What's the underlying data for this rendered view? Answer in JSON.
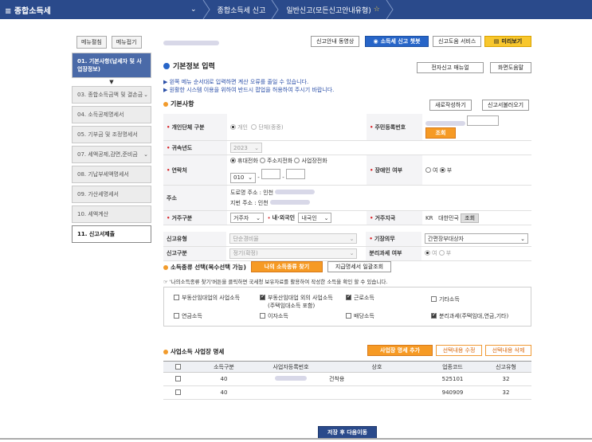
{
  "topbar": {
    "menu_label": "≡ 종합소득세",
    "crumbs": [
      "종합소득세 신고",
      "일반신고(모든신고안내유형)"
    ],
    "home_chevron": "⌄"
  },
  "sidebar": {
    "btn_expand": "메뉴펼침",
    "btn_collapse": "메뉴접기",
    "items": [
      {
        "label": "01. 기본사항(납세자 및 사업장정보)",
        "state": "active"
      },
      {
        "label": "03. 종합소득금액 및 결손금",
        "state": "normal",
        "chev": true
      },
      {
        "label": "04. 소득공제명세서",
        "state": "normal"
      },
      {
        "label": "05. 기부금 및 조정명세서",
        "state": "normal"
      },
      {
        "label": "07. 세액공제,감면,준비금",
        "state": "normal",
        "chev": true
      },
      {
        "label": "08. 기납부세액명세서",
        "state": "normal"
      },
      {
        "label": "09. 가산세명세서",
        "state": "normal"
      },
      {
        "label": "10. 세액계산",
        "state": "normal"
      },
      {
        "label": "11. 신고서제출",
        "state": "current"
      }
    ]
  },
  "toolbar": {
    "video_guide": "신고안내 동영상",
    "chatbot": "소득세 신고 챗봇",
    "help_service": "신고도움 서비스",
    "preview": "미리보기"
  },
  "basic": {
    "title": "기본정보 입력",
    "manual_btn": "전자신고 매뉴얼",
    "help_btn": "화면도움말",
    "note1": "▶ 왼쪽 메뉴 순서대로 입력하면 계산 오류를 줄일 수 있습니다.",
    "note2": "▶ 원활한 시스템 이용을 위하여 반드시 팝업을 허용하여 주시기 바랍니다.",
    "subtitle": "기본사항",
    "new_btn": "새로작성하기",
    "load_btn": "신고서불러오기"
  },
  "form": {
    "taxpayer_type_label": "개인단체 구분",
    "individual": "개인",
    "group": "단체(종중)",
    "rrn_label": "주민등록번호",
    "lookup_btn": "조회",
    "year_label": "귀속년도",
    "year_value": "2023",
    "contact_label": "연락처",
    "contact_mobile": "휴대전화",
    "contact_home": "주소지전화",
    "contact_office": "사업장전화",
    "phone_prefix": "010",
    "disabled_label": "장애인 여부",
    "yes": "여",
    "no": "부",
    "address_label": "주소",
    "road_address": "도로명 주소 : 인천",
    "lot_address": "지번 주소 : 인천",
    "resident_label": "거주구분",
    "resident_value": "거주자",
    "nationality_label": "내·외국인",
    "nationality_value": "내국인",
    "region_label": "거주지국",
    "country_code": "KR",
    "country_name": "대한민국",
    "region_btn": "조회",
    "report_type_label": "신고유형",
    "report_type_value": "단순경비율",
    "bookkeeping_label": "기장의무",
    "bookkeeping_value": "간편장부대상자",
    "report_kind_label": "신고구분",
    "report_kind_value": "정기(확정)",
    "separate_label": "분리과세 여부"
  },
  "income": {
    "title": "소득종류 선택(복수선택 가능)",
    "find_btn": "나의 소득종류 찾기",
    "payment_btn": "지급명세서 일괄조회",
    "note": "☞ '나의소득종류 찾기'버튼을 클릭하면 국세청 보유자료를 활용하여 작성한 소득을 확인 할 수 있습니다.",
    "items": [
      {
        "label": "부동산임대업의 사업소득",
        "checked": false
      },
      {
        "label": "부동산임대업 외의 사업소득",
        "sub": "(주택임대소득 포함)",
        "checked": true
      },
      {
        "label": "근로소득",
        "checked": true
      },
      {
        "label": "기타소득",
        "checked": false
      },
      {
        "label": "연금소득",
        "checked": false
      },
      {
        "label": "이자소득",
        "checked": false
      },
      {
        "label": "배당소득",
        "checked": false
      },
      {
        "label": "분리과세(주택임대,연금,기타)",
        "checked": true
      }
    ]
  },
  "business": {
    "title": "사업소득 사업장 명세",
    "add_btn": "사업장 명세 추가",
    "edit_btn": "선택내용 수정",
    "delete_btn": "선택내용 삭제",
    "columns": [
      "",
      "소득구분",
      "사업자등록번호",
      "상호",
      "업종코드",
      "신고유형"
    ],
    "rows": [
      {
        "income_type": "40",
        "name": "건착용",
        "industry": "525101",
        "report_type": "32"
      },
      {
        "income_type": "40",
        "name": "",
        "industry": "940909",
        "report_type": "32"
      }
    ]
  },
  "footer": {
    "save_next": "저장 후 다음이동"
  }
}
